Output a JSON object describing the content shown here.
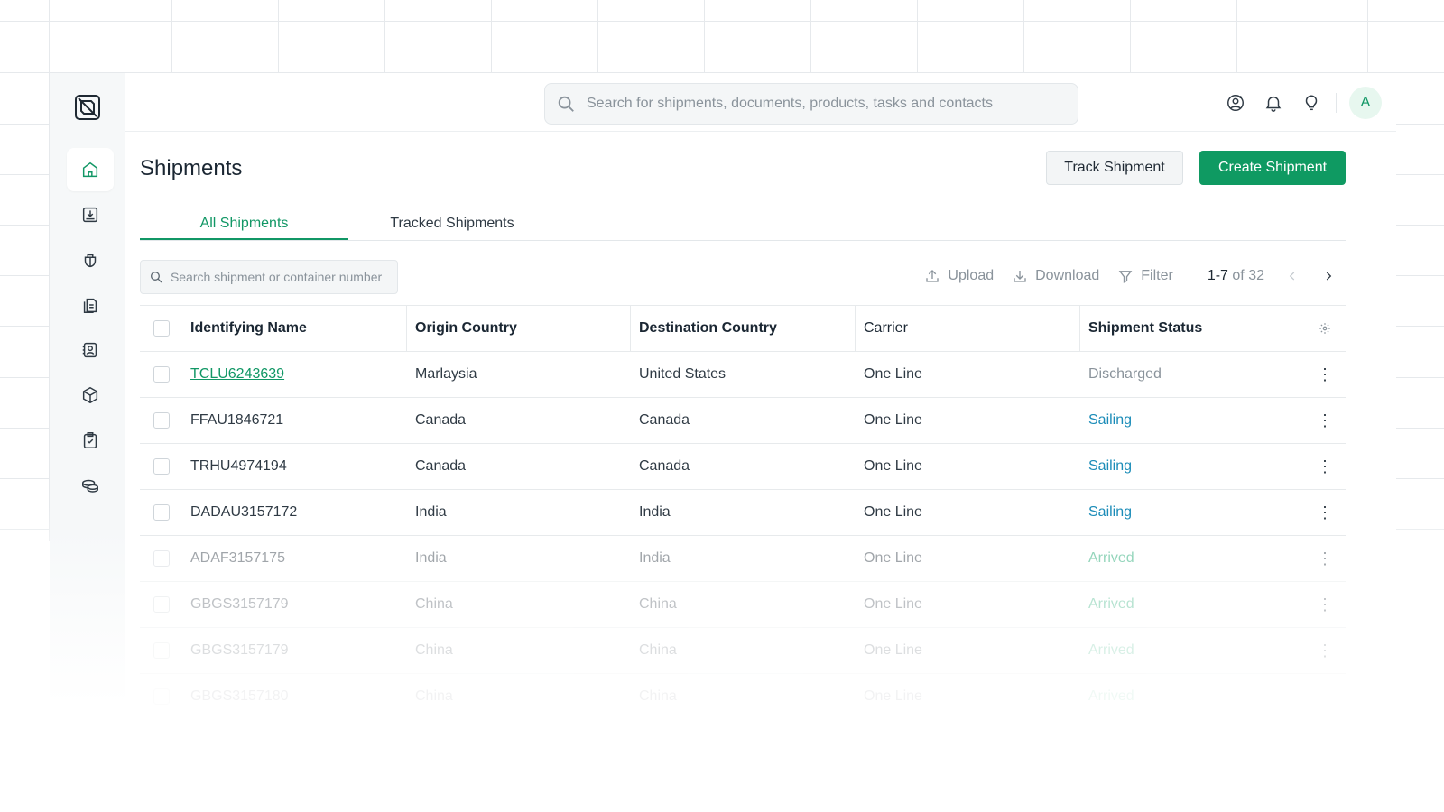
{
  "search": {
    "placeholder": "Search for shipments, documents, products, tasks and contacts"
  },
  "user": {
    "avatar_initial": "A"
  },
  "page": {
    "title": "Shipments"
  },
  "actions": {
    "track_label": "Track Shipment",
    "create_label": "Create Shipment"
  },
  "tabs": [
    {
      "label": "All Shipments",
      "active": true
    },
    {
      "label": "Tracked Shipments",
      "active": false
    }
  ],
  "table_search": {
    "placeholder": "Search shipment or container number"
  },
  "toolbar": {
    "upload_label": "Upload",
    "download_label": "Download",
    "filter_label": "Filter",
    "pager_range": "1-7",
    "pager_total": "of 32"
  },
  "table": {
    "columns": [
      "Identifying Name",
      "Origin Country",
      "Destination Country",
      "Carrier",
      "Shipment Status"
    ],
    "rows": [
      {
        "name": "TCLU6243639",
        "origin": "Marlaysia",
        "destination": "United States",
        "carrier": "One Line",
        "status": "Discharged"
      },
      {
        "name": "FFAU1846721",
        "origin": "Canada",
        "destination": "Canada",
        "carrier": "One Line",
        "status": "Sailing"
      },
      {
        "name": "TRHU4974194",
        "origin": "Canada",
        "destination": "Canada",
        "carrier": "One Line",
        "status": "Sailing"
      },
      {
        "name": "DADAU3157172",
        "origin": "India",
        "destination": "India",
        "carrier": "One Line",
        "status": "Sailing"
      },
      {
        "name": "ADAF3157175",
        "origin": "India",
        "destination": "India",
        "carrier": "One Line",
        "status": "Arrived"
      },
      {
        "name": "GBGS3157179",
        "origin": "China",
        "destination": "China",
        "carrier": "One Line",
        "status": "Arrived"
      },
      {
        "name": "GBGS3157179",
        "origin": "China",
        "destination": "China",
        "carrier": "One Line",
        "status": "Arrived"
      },
      {
        "name": "GBGS3157180",
        "origin": "China",
        "destination": "China",
        "carrier": "One Line",
        "status": "Arrived"
      }
    ]
  },
  "colors": {
    "accent": "#0f9a62",
    "sailing": "#1b8cb8",
    "arrived": "#14a46b",
    "discharged": "#8a939b"
  },
  "icons": {
    "sidebar": [
      "logo-icon",
      "home-icon",
      "inbox-download-icon",
      "ship-icon",
      "documents-icon",
      "contacts-icon",
      "box-icon",
      "tasks-icon",
      "coins-icon"
    ],
    "topbar": [
      "search-icon",
      "user-settings-icon",
      "bell-icon",
      "lightbulb-icon"
    ]
  }
}
